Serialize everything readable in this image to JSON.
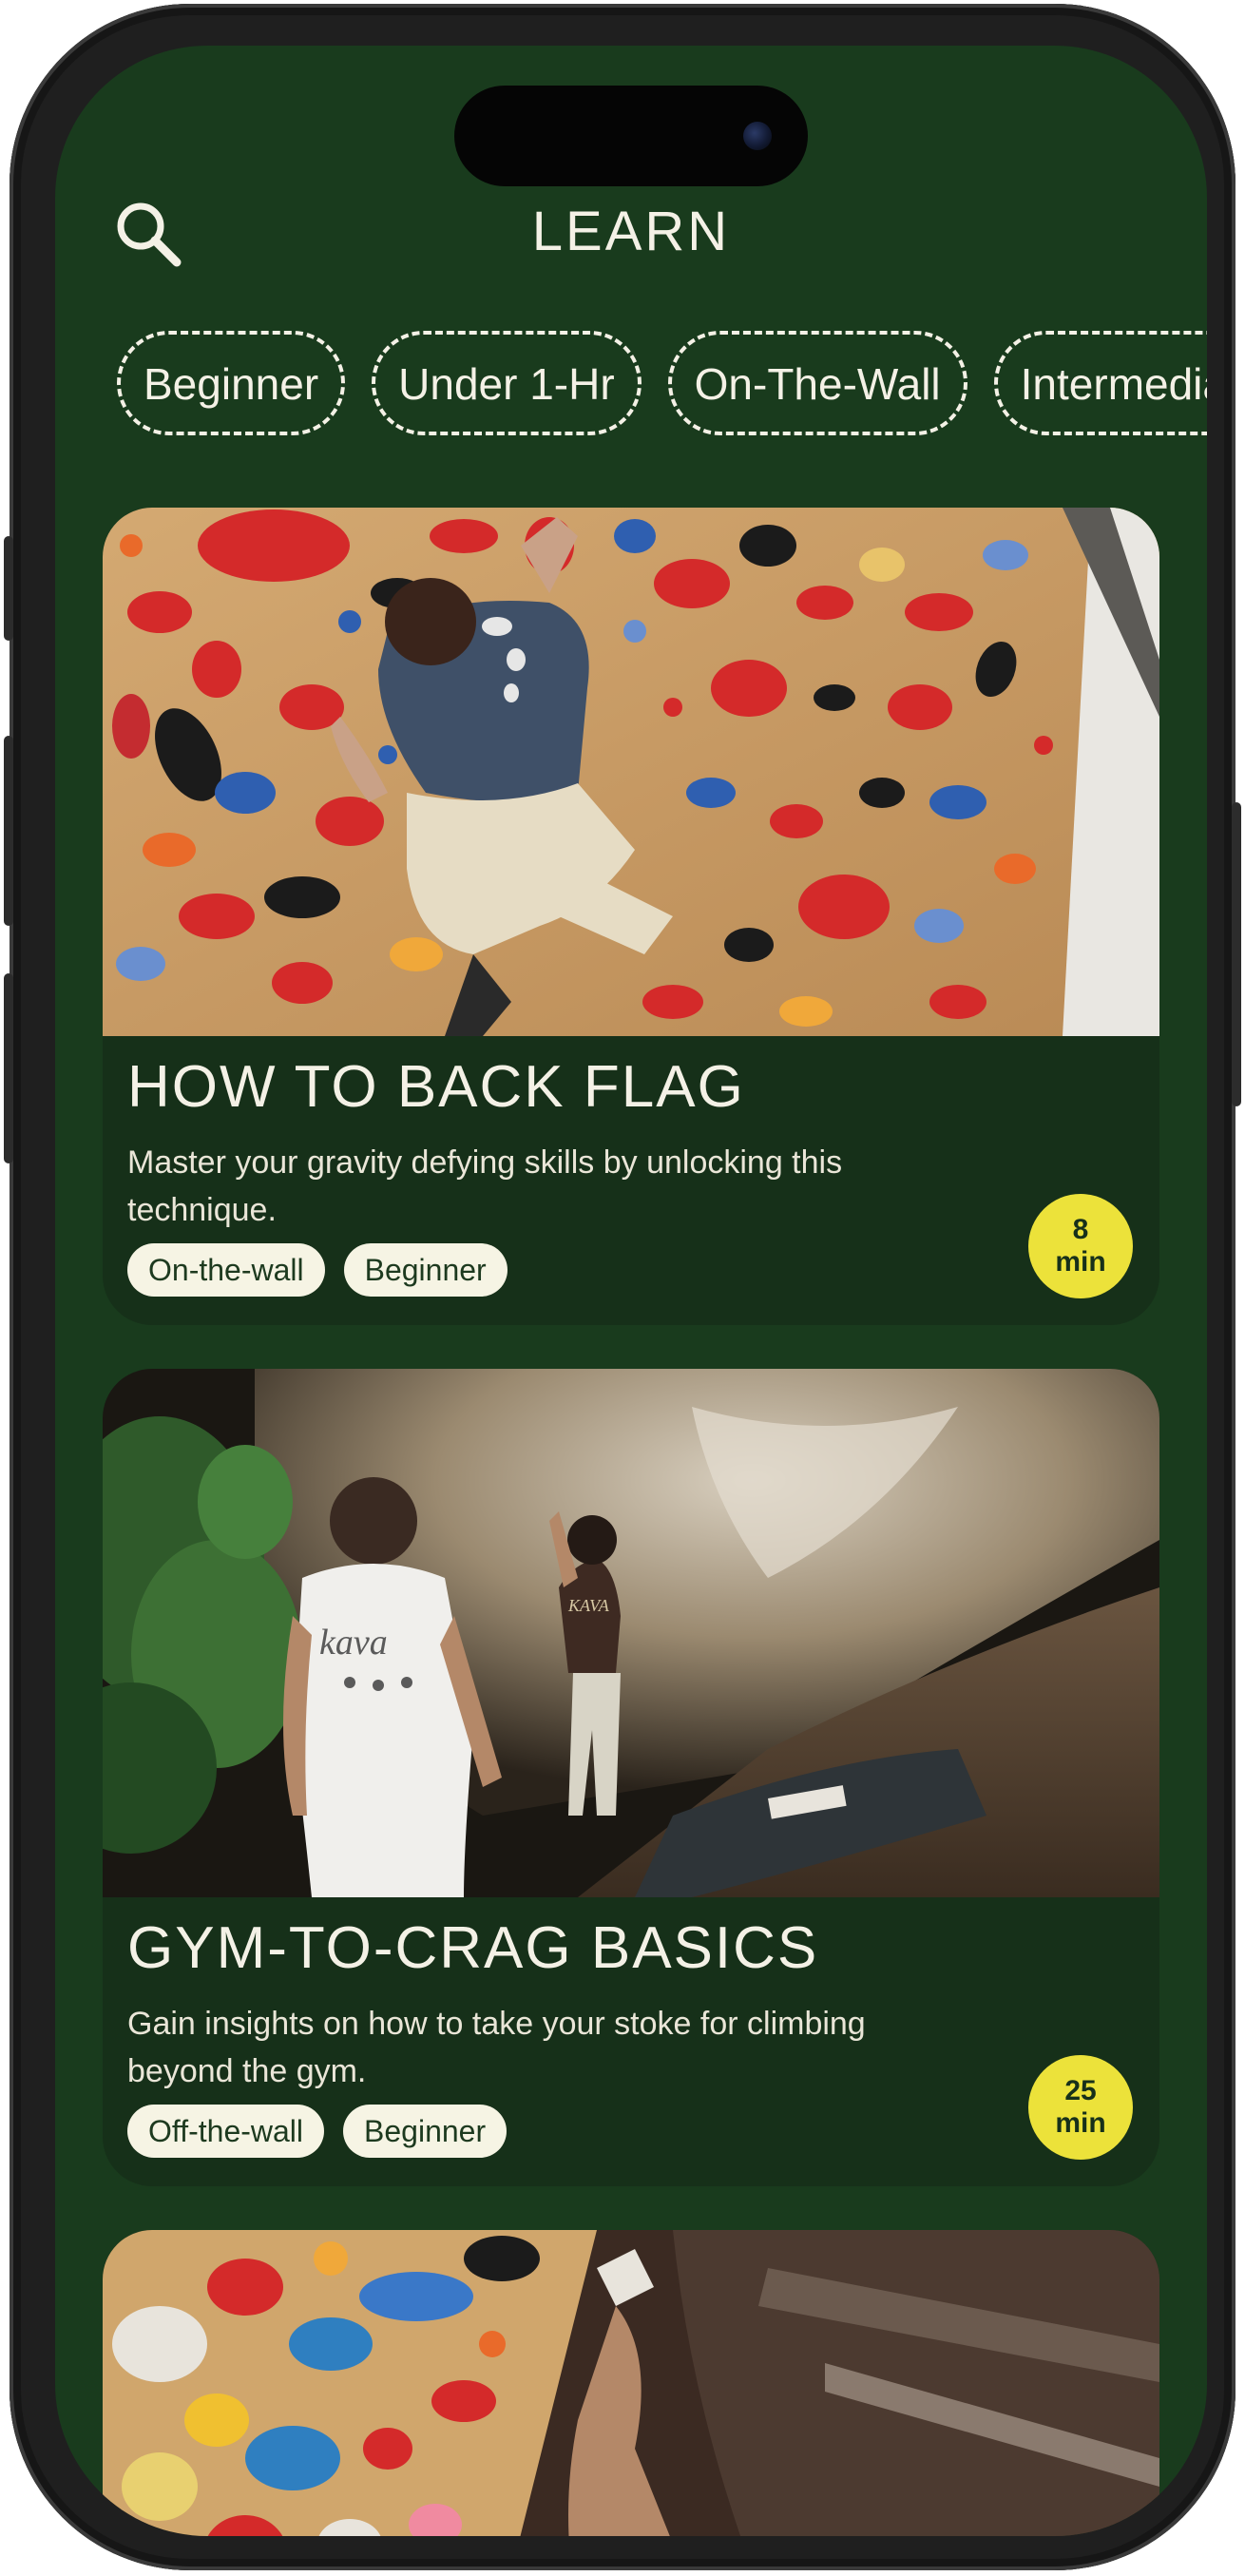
{
  "header": {
    "title": "LEARN",
    "search_icon": "search-icon"
  },
  "filters": [
    {
      "label": "Beginner"
    },
    {
      "label": "Under 1-Hr"
    },
    {
      "label": "On-The-Wall"
    },
    {
      "label": "Intermediate"
    }
  ],
  "lessons": [
    {
      "title": "HOW TO BACK FLAG",
      "description": "Master your gravity defying skills by unlocking this technique.",
      "tags": [
        "On-the-wall",
        "Beginner"
      ],
      "duration_value": "8",
      "duration_unit": "min"
    },
    {
      "title": "GYM-TO-CRAG BASICS",
      "description": "Gain insights on how to take your stoke for climbing beyond the gym.",
      "tags": [
        "Off-the-wall",
        "Beginner"
      ],
      "duration_value": "25",
      "duration_unit": "min"
    },
    {
      "title": "",
      "description": "",
      "tags": [],
      "duration_value": "",
      "duration_unit": ""
    }
  ],
  "colors": {
    "background": "#193b1d",
    "card": "#163019",
    "chip_border": "#f4f1e6",
    "tag_bg": "#f6f4e4",
    "badge": "#ece23a"
  }
}
